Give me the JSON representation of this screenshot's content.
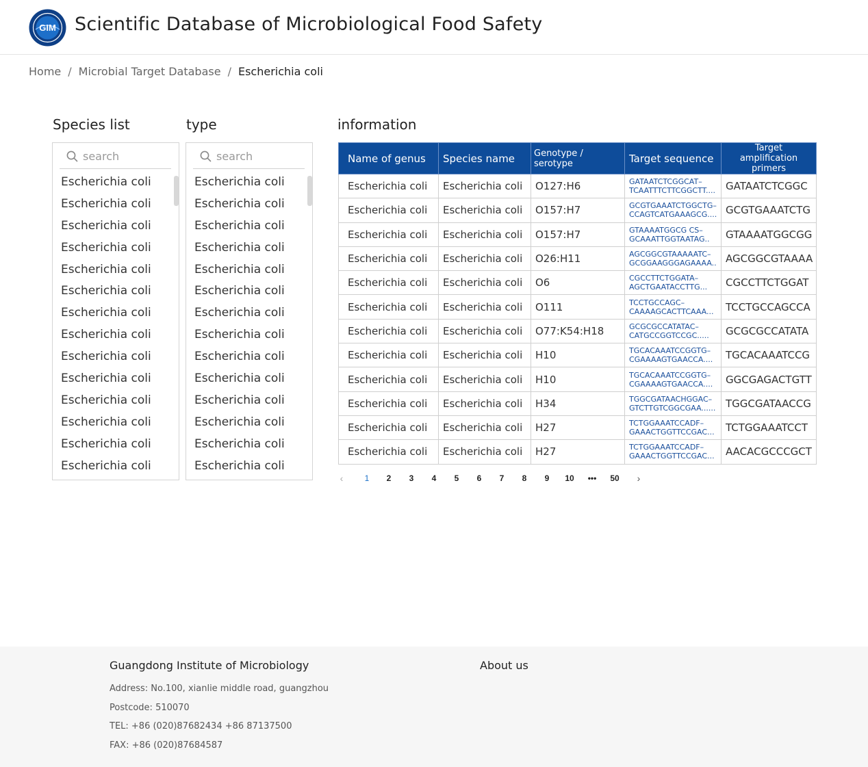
{
  "header": {
    "title": "Scientific Database of Microbiological Food Safety",
    "logo_text": "GIM"
  },
  "breadcrumb": {
    "home": "Home",
    "sep": "/",
    "parent": "Microbial Target Database",
    "current": "Escherichia coli"
  },
  "species_list": {
    "title": "Species list",
    "search_placeholder": "search",
    "items": [
      "Escherichia coli",
      "Escherichia coli",
      "Escherichia coli",
      "Escherichia coli",
      "Escherichia coli",
      "Escherichia coli",
      "Escherichia coli",
      "Escherichia coli",
      "Escherichia coli",
      "Escherichia coli",
      "Escherichia coli",
      "Escherichia coli",
      "Escherichia coli",
      "Escherichia coli"
    ]
  },
  "type_list": {
    "title": "type",
    "search_placeholder": "search",
    "items": [
      "Escherichia coli",
      "Escherichia coli",
      "Escherichia coli",
      "Escherichia coli",
      "Escherichia coli",
      "Escherichia coli",
      "Escherichia coli",
      "Escherichia coli",
      "Escherichia coli",
      "Escherichia coli",
      "Escherichia coli",
      "Escherichia coli",
      "Escherichia coli",
      "Escherichia coli"
    ]
  },
  "information": {
    "title": "information",
    "columns": [
      "Name of genus",
      "Species name",
      "Genotype / serotype",
      "Target sequence",
      "Target amplification primers"
    ],
    "rows": [
      {
        "genus": "Escherichia coli",
        "species": "Escherichia coli",
        "genotype": "O127:H6",
        "seq1": "GATAATCTCGGCAT–",
        "seq2": "TCAATTTCTTCGGCTT....",
        "primer": "GATAATCTCGGC"
      },
      {
        "genus": "Escherichia coli",
        "species": "Escherichia coli",
        "genotype": "O157:H7",
        "seq1": "GCGTGAAATCTGGCTG–",
        "seq2": "CCAGTCATGAAAGCG....",
        "primer": "GCGTGAAATCTG"
      },
      {
        "genus": "Escherichia coli",
        "species": "Escherichia coli",
        "genotype": "O157:H7",
        "seq1": "GTAAAATGGCG CS–",
        "seq2": "GCAAATTGGTAATAG..",
        "primer": "GTAAAATGGCGG"
      },
      {
        "genus": "Escherichia coli",
        "species": "Escherichia coli",
        "genotype": "O26:H11",
        "seq1": "AGCGGCGTAAAAATC–",
        "seq2": "GCGGAAGGGAGAAAA..",
        "primer": "AGCGGCGTAAAA"
      },
      {
        "genus": "Escherichia coli",
        "species": "Escherichia coli",
        "genotype": "O6",
        "seq1": "CGCCTTCTGGATA–",
        "seq2": "AGCTGAATACCTTG...",
        "primer": "CGCCTTCTGGAT"
      },
      {
        "genus": "Escherichia coli",
        "species": "Escherichia coli",
        "genotype": "O111",
        "seq1": "TCCTGCCAGC–",
        "seq2": "CAAAAGCACTTCAAA...",
        "primer": "TCCTGCCAGCCA"
      },
      {
        "genus": "Escherichia coli",
        "species": "Escherichia coli",
        "genotype": "O77:K54:H18",
        "seq1": "GCGCGCCATATAC–",
        "seq2": "CATGCCGGTCCGC.....",
        "primer": "GCGCGCCATATA"
      },
      {
        "genus": "Escherichia coli",
        "species": "Escherichia coli",
        "genotype": "H10",
        "seq1": "TGCACAAATCCGGTG–",
        "seq2": "CGAAAAGTGAACCA....",
        "primer": "TGCACAAATCCG"
      },
      {
        "genus": "Escherichia coli",
        "species": "Escherichia coli",
        "genotype": "H10",
        "seq1": "TGCACAAATCCGGTG–",
        "seq2": "CGAAAAGTGAACCA....",
        "primer": "GGCGAGACTGTT"
      },
      {
        "genus": "Escherichia coli",
        "species": "Escherichia coli",
        "genotype": "H34",
        "seq1": "TGGCGATAACHGGAC–",
        "seq2": "GTCTTGTCGGCGAA......",
        "primer": "TGGCGATAACCG"
      },
      {
        "genus": "Escherichia coli",
        "species": "Escherichia coli",
        "genotype": "H27",
        "seq1": "TCTGGAAATCCADF–",
        "seq2": "GAAACTGGTTCCGAC...",
        "primer": "TCTGGAAATCCT"
      },
      {
        "genus": "Escherichia coli",
        "species": "Escherichia coli",
        "genotype": "H27",
        "seq1": "TCTGGAAATCCADF–",
        "seq2": "GAAACTGGTTCCGAC...",
        "primer": "AACACGCCCGCT"
      }
    ]
  },
  "pagination": {
    "prev": "‹",
    "next": "›",
    "pages": [
      "1",
      "2",
      "3",
      "4",
      "5",
      "6",
      "7",
      "8",
      "9",
      "10",
      "•••",
      "50"
    ],
    "current": "1"
  },
  "footer": {
    "org": "Guangdong Institute of Microbiology",
    "about": "About us",
    "address": "Address: No.100, xianlie middle road, guangzhou",
    "postcode": "Postcode:  510070",
    "tel": "TEL:  +86 (020)87682434    +86 87137500",
    "fax": "FAX:  +86 (020)87684587"
  },
  "colors": {
    "table_header": "#0e4c9a",
    "sequence_text": "#1a4f9c",
    "active_page": "#1b71c9",
    "footer_bg": "#f6f6f6"
  }
}
